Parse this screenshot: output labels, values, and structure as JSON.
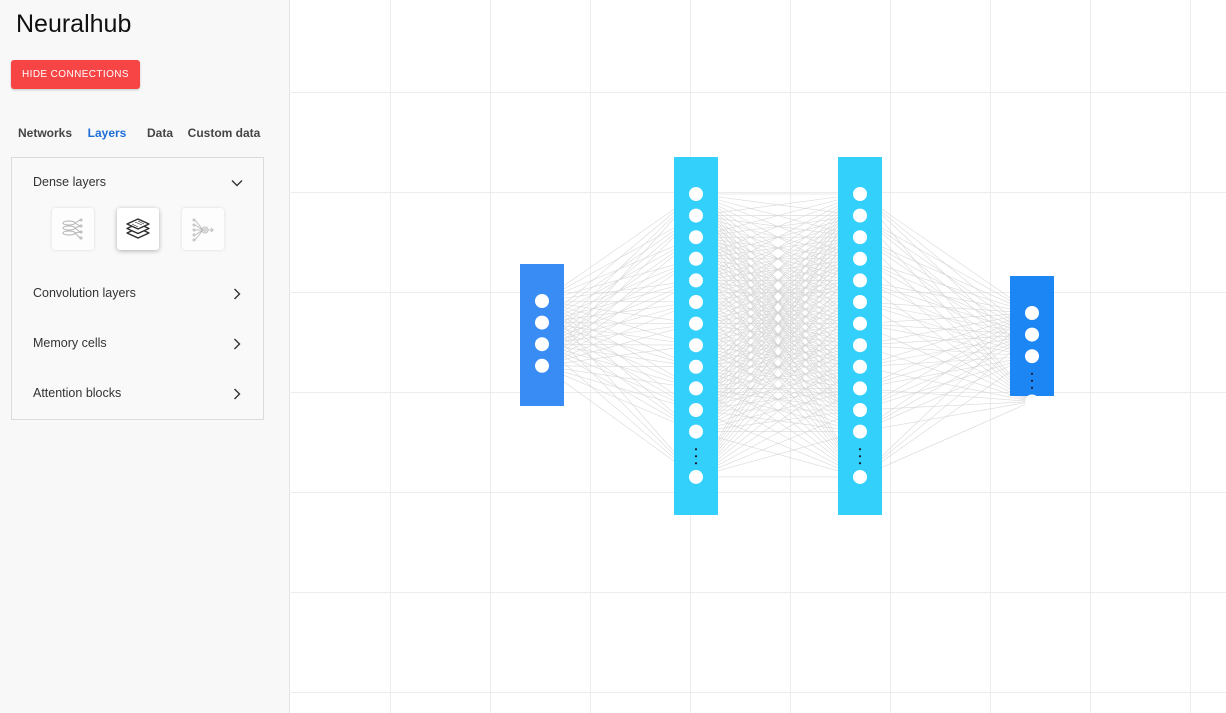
{
  "app": {
    "title": "Neuralhub"
  },
  "toolbar": {
    "hide_connections_label": "HIDE CONNECTIONS"
  },
  "tabs": [
    {
      "label": "Networks",
      "active": false
    },
    {
      "label": "Layers",
      "active": true
    },
    {
      "label": "Data",
      "active": false
    },
    {
      "label": "Custom data",
      "active": false
    }
  ],
  "sections": [
    {
      "label": "Dense layers",
      "expanded": true,
      "icon": "chevron-down-icon"
    },
    {
      "label": "Convolution layers",
      "expanded": false,
      "icon": "chevron-right-icon"
    },
    {
      "label": "Memory cells",
      "expanded": false,
      "icon": "chevron-right-icon"
    },
    {
      "label": "Attention blocks",
      "expanded": false,
      "icon": "chevron-right-icon"
    }
  ],
  "dense_layer_tiles": [
    {
      "icon": "dense-network-icon",
      "selected": false
    },
    {
      "icon": "stacked-layers-icon",
      "selected": true
    },
    {
      "icon": "output-node-icon",
      "selected": false
    }
  ],
  "network": {
    "layers": [
      {
        "name": "input",
        "visible_neurons": 4,
        "ellipsis": false,
        "color": "#3a8cf5"
      },
      {
        "name": "hidden-1",
        "visible_neurons": 13,
        "ellipsis": true,
        "color": "#33d0fb"
      },
      {
        "name": "hidden-2",
        "visible_neurons": 13,
        "ellipsis": true,
        "color": "#33d0fb"
      },
      {
        "name": "output",
        "visible_neurons": 4,
        "ellipsis": true,
        "color": "#1b86f4"
      }
    ],
    "connections_visible": true,
    "connection_color": "#d2d2d2"
  },
  "colors": {
    "accent": "#1e6ed8",
    "danger": "#f74545"
  }
}
